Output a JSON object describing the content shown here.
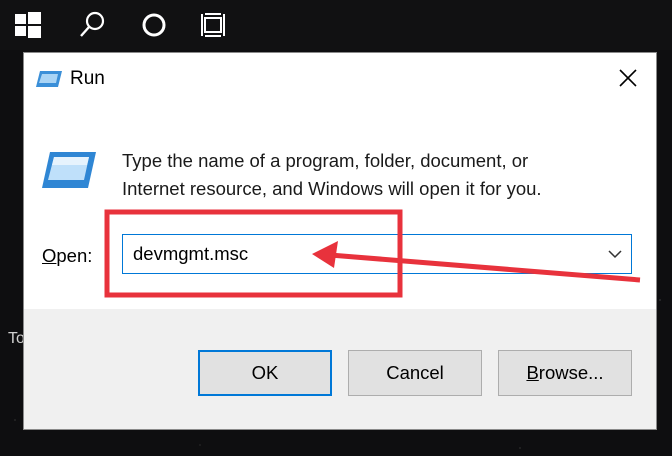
{
  "desktop": {
    "partial_text": "To"
  },
  "taskbar": {
    "icons": [
      "windows-start-icon",
      "search-icon",
      "cortana-icon",
      "task-view-icon"
    ]
  },
  "dialog": {
    "title": "Run",
    "description_line1": "Type the name of a program, folder, document, or",
    "description_line2": "Internet resource, and Windows will open it for you.",
    "open_label_first": "O",
    "open_label_rest": "pen:",
    "open_value": "devmgmt.msc",
    "buttons": {
      "ok": "OK",
      "cancel": "Cancel",
      "browse_first": "B",
      "browse_rest": "rowse..."
    }
  },
  "annotation": {
    "color": "#e8323c"
  }
}
